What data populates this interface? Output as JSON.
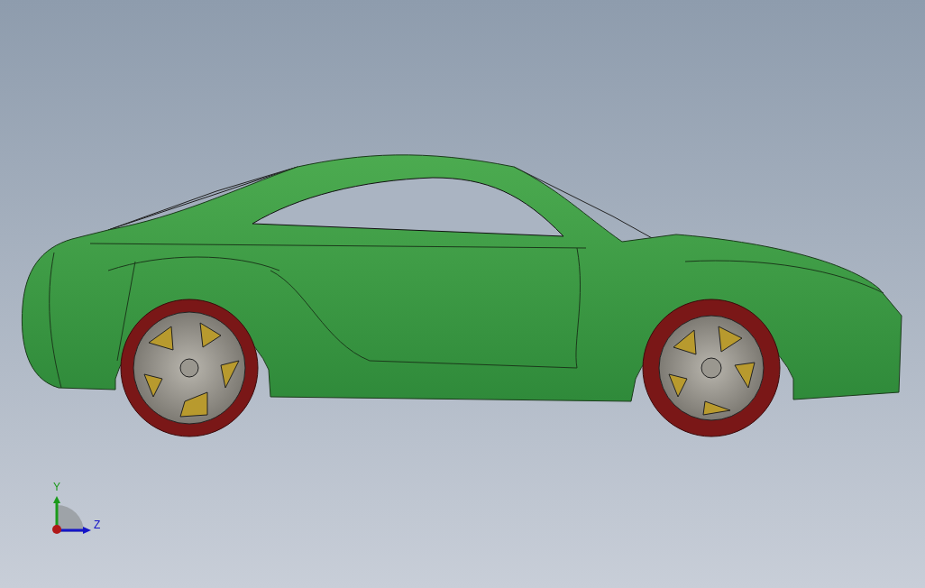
{
  "viewport": {
    "triad": {
      "axes": [
        {
          "label": "Y",
          "kind": "vertical",
          "color": "#1a9a1a"
        },
        {
          "label": "Z",
          "kind": "horizontal",
          "color": "#1515c8"
        }
      ]
    }
  }
}
